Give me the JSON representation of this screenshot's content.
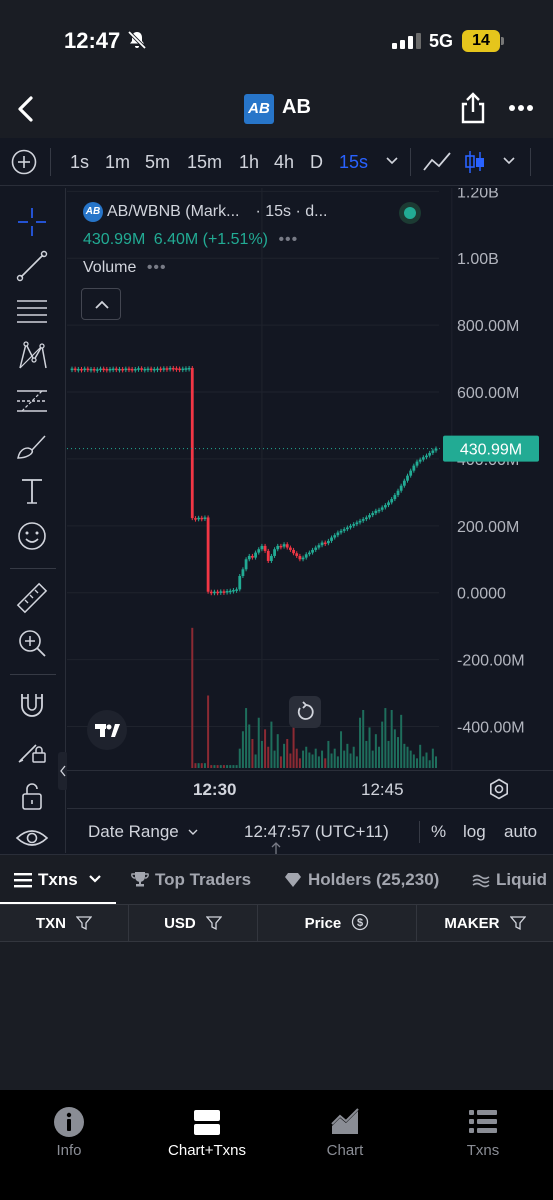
{
  "status_bar": {
    "time": "12:47",
    "network": "5G",
    "battery": "14"
  },
  "nav": {
    "logo_text": "AB",
    "title": "AB"
  },
  "toolbar": {
    "intervals": [
      "1s",
      "1m",
      "5m",
      "15m",
      "1h",
      "4h",
      "D",
      "15s"
    ],
    "active_interval": "15s"
  },
  "legend": {
    "symbol": "AB/WBNB (Mark...",
    "meta": "· 15s · d...",
    "price": "430.99M",
    "change": "6.40M (+1.51%)",
    "indicator": "Volume"
  },
  "colors": {
    "up": "#22ab94",
    "down": "#f23645",
    "accent": "#2962ff",
    "bg": "#131722"
  },
  "chart_data": {
    "type": "candlestick",
    "y_ticks": [
      "1.20B",
      "1.00B",
      "800.00M",
      "600.00M",
      "400.00M",
      "200.00M",
      "0.0000",
      "-200.00M",
      "-400.00M"
    ],
    "y_tick_values": [
      1200,
      1000,
      800,
      600,
      400,
      200,
      0,
      -200,
      -400
    ],
    "ylim": [
      -530,
      1210
    ],
    "x_ticks": [
      "12:30",
      "12:45"
    ],
    "x_tick_index": [
      60,
      120
    ],
    "last_price_label": "430.99M",
    "last_price": 430.99,
    "price_series": [
      670,
      668,
      669,
      668,
      670,
      668,
      669,
      667,
      668,
      670,
      669,
      668,
      669,
      670,
      668,
      669,
      668,
      670,
      669,
      668,
      669,
      671,
      668,
      669,
      670,
      668,
      669,
      670,
      669,
      671,
      670,
      672,
      671,
      670,
      669,
      670,
      671,
      672,
      223,
      222,
      224,
      223,
      225,
      3,
      2,
      3,
      2,
      4,
      3,
      5,
      6,
      8,
      10,
      50,
      70,
      100,
      110,
      105,
      120,
      130,
      140,
      125,
      95,
      110,
      130,
      140,
      138,
      145,
      135,
      128,
      118,
      110,
      100,
      105,
      115,
      120,
      128,
      135,
      142,
      150,
      148,
      155,
      165,
      172,
      180,
      185,
      190,
      195,
      200,
      205,
      210,
      215,
      220,
      225,
      232,
      238,
      245,
      248,
      255,
      262,
      270,
      280,
      292,
      305,
      320,
      335,
      350,
      365,
      380,
      392,
      398,
      405,
      410,
      418,
      425,
      431
    ],
    "volume_series": [
      0,
      0,
      0,
      0,
      0,
      0,
      0,
      0,
      0,
      0,
      0,
      0,
      0,
      0,
      0,
      0,
      0,
      0,
      0,
      0,
      0,
      0,
      0,
      0,
      0,
      0,
      0,
      0,
      0,
      0,
      0,
      0,
      0,
      0,
      0,
      0,
      0,
      0,
      145,
      5,
      5,
      5,
      5,
      75,
      3,
      3,
      3,
      3,
      3,
      3,
      3,
      3,
      3,
      20,
      38,
      62,
      45,
      30,
      14,
      52,
      28,
      40,
      22,
      48,
      18,
      35,
      12,
      25,
      30,
      15,
      42,
      20,
      10,
      18,
      22,
      16,
      14,
      20,
      12,
      18,
      10,
      28,
      15,
      20,
      12,
      38,
      18,
      25,
      15,
      22,
      12,
      52,
      60,
      28,
      42,
      18,
      35,
      22,
      48,
      62,
      28,
      60,
      40,
      32,
      55,
      25,
      22,
      18,
      14,
      10,
      24,
      12,
      16,
      8,
      20,
      12
    ],
    "volume_ylim": [
      0,
      150
    ]
  },
  "time_axis": {
    "labels": [
      "12:30",
      "12:45"
    ]
  },
  "bottom_bar": {
    "date_range": "Date Range",
    "clock": "12:47:57 (UTC+11)",
    "percent": "%",
    "log": "log",
    "auto": "auto"
  },
  "tabs": [
    "Txns",
    "Top Traders",
    "Holders (25,230)",
    "Liquid"
  ],
  "table": {
    "headers": [
      "TXN",
      "USD",
      "Price",
      "MAKER"
    ]
  },
  "app_nav": [
    "Info",
    "Chart+Txns",
    "Chart",
    "Txns"
  ]
}
